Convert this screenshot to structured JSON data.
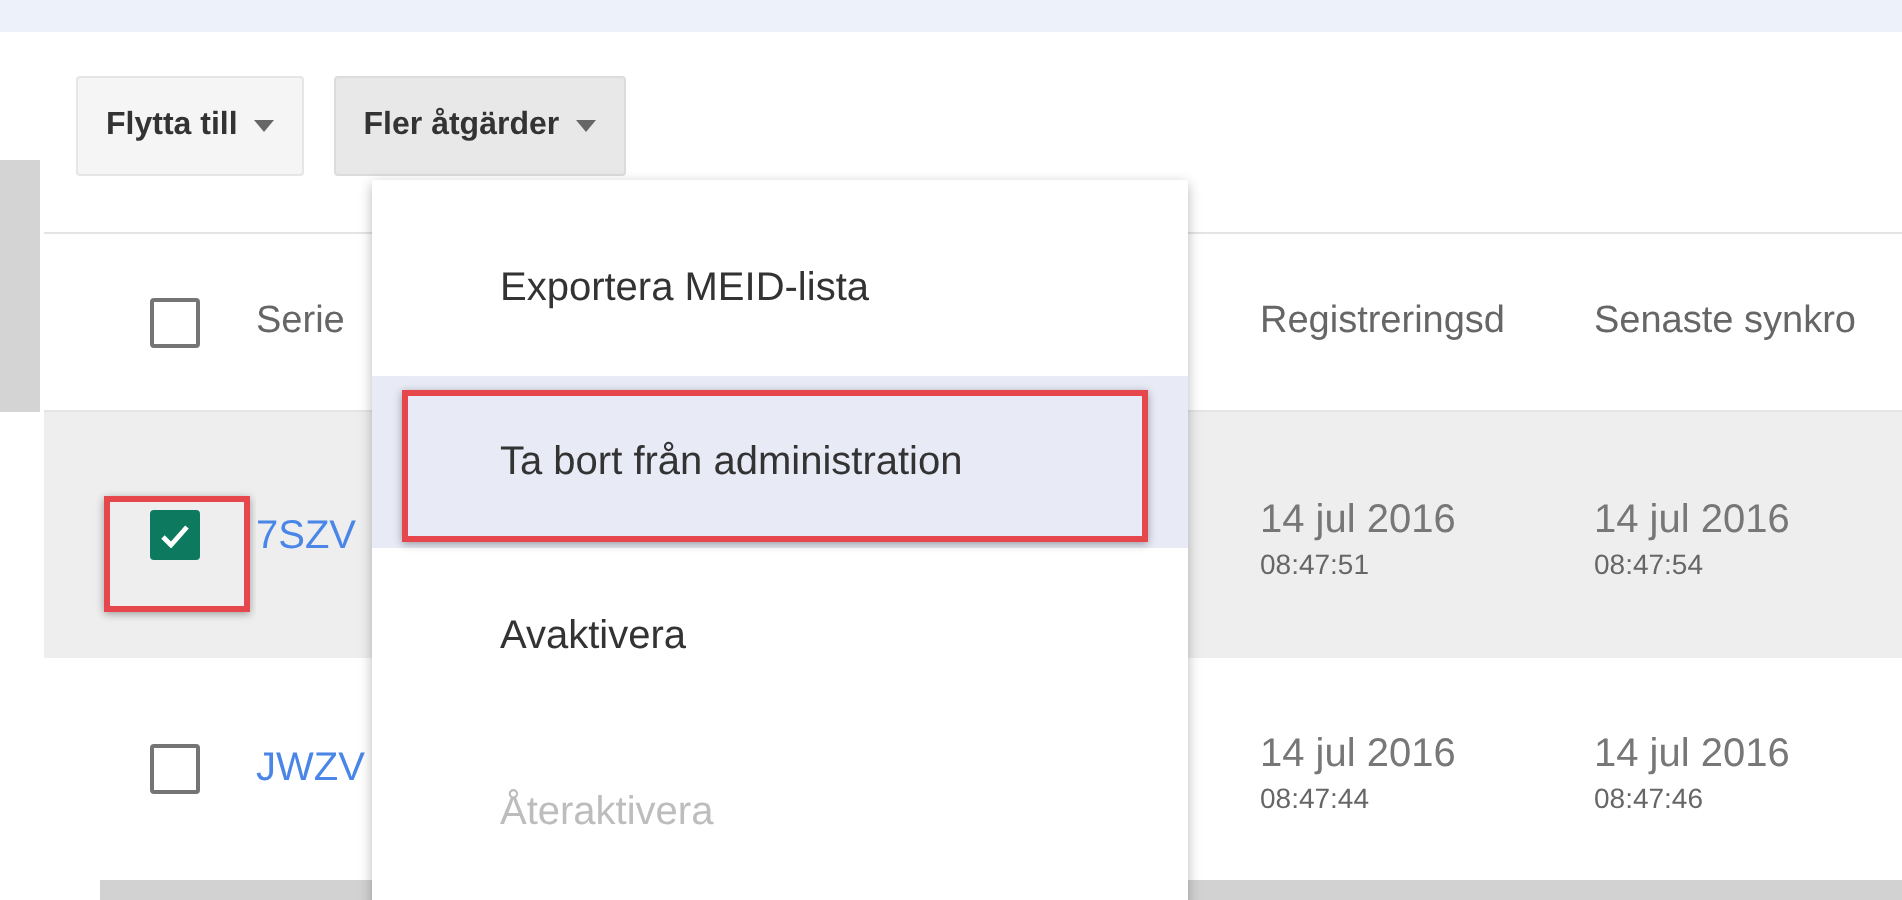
{
  "toolbar": {
    "buttons": [
      {
        "label": "Flytta till",
        "pressed": false
      },
      {
        "label": "Fler åtgärder",
        "pressed": true
      }
    ]
  },
  "table": {
    "header_checkbox": {
      "checked": false
    },
    "columns": [
      "Serie",
      "Registreringsd",
      "Senaste synkro"
    ],
    "rows": [
      {
        "checked": true,
        "selected": true,
        "annotated": true,
        "serial": "7SZV",
        "registered": {
          "date": "14 jul 2016",
          "time": "08:47:51"
        },
        "synced": {
          "date": "14 jul 2016",
          "time": "08:47:54"
        }
      },
      {
        "checked": false,
        "selected": false,
        "annotated": false,
        "serial": "JWZV",
        "registered": {
          "date": "14 jul 2016",
          "time": "08:47:44"
        },
        "synced": {
          "date": "14 jul 2016",
          "time": "08:47:46"
        }
      }
    ]
  },
  "menu": {
    "items": [
      {
        "label": "Exportera MEID-lista",
        "selected": false,
        "disabled": false,
        "annotated": false
      },
      {
        "label": "Ta bort från administration",
        "selected": true,
        "disabled": false,
        "annotated": true
      },
      {
        "label": "Avaktivera",
        "selected": false,
        "disabled": false,
        "annotated": false
      },
      {
        "label": "Återaktivera",
        "selected": false,
        "disabled": true,
        "annotated": false
      }
    ]
  }
}
